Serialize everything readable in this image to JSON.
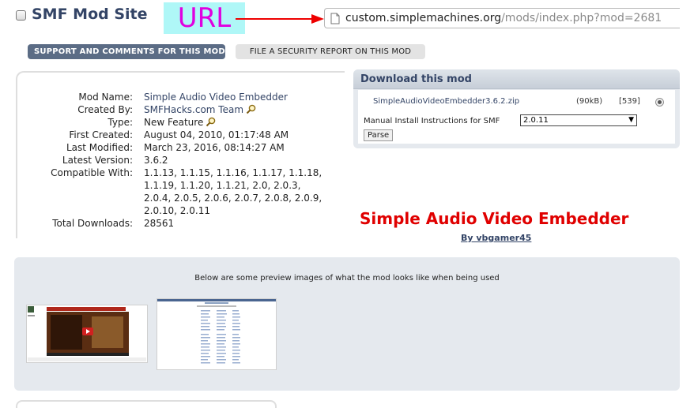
{
  "header": {
    "site_title": "SMF Mod Site",
    "annotation_label": "URL",
    "url_host": "custom.simplemachines.org",
    "url_path": "/mods/index.php?mod=2681",
    "colors": {
      "annotation_bg": "#aff7f7",
      "annotation_text": "#e000e0",
      "arrow": "#ee0000"
    }
  },
  "actions": {
    "support_label": "SUPPORT AND COMMENTS FOR THIS MOD",
    "security_label": "FILE A SECURITY REPORT ON THIS MOD"
  },
  "info": {
    "mod_name_label": "Mod Name:",
    "mod_name": "Simple Audio Video Embedder",
    "created_by_label": "Created By:",
    "created_by": "SMFHacks.com Team",
    "type_label": "Type:",
    "type": "New Feature",
    "first_created_label": "First Created:",
    "first_created": "August 04, 2010, 01:17:48 AM",
    "last_modified_label": "Last Modified:",
    "last_modified": "March 23, 2016, 08:14:27 AM",
    "latest_version_label": "Latest Version:",
    "latest_version": "3.6.2",
    "compatible_label": "Compatible With:",
    "compatible_lines": [
      "1.1.13, 1.1.15, 1.1.16, 1.1.17, 1.1.18,",
      "1.1.19, 1.1.20, 1.1.21, 2.0, 2.0.3,",
      "2.0.4, 2.0.5, 2.0.6, 2.0.7, 2.0.8, 2.0.9,",
      "2.0.10, 2.0.11"
    ],
    "downloads_label": "Total Downloads:",
    "downloads": "28561"
  },
  "download": {
    "title": "Download this mod",
    "file_name": "SimpleAudioVideoEmbedder3.6.2.zip",
    "file_size": "(90kB)",
    "file_count": "[539]",
    "manual_label": "Manual Install Instructions for SMF",
    "smf_version": "2.0.11",
    "parse_label": "Parse"
  },
  "mod_title": {
    "title": "Simple Audio Video Embedder",
    "author": "By vbgamer45",
    "title_color": "#e00000"
  },
  "preview": {
    "text": "Below are some preview images of what the mod looks like when being used"
  }
}
